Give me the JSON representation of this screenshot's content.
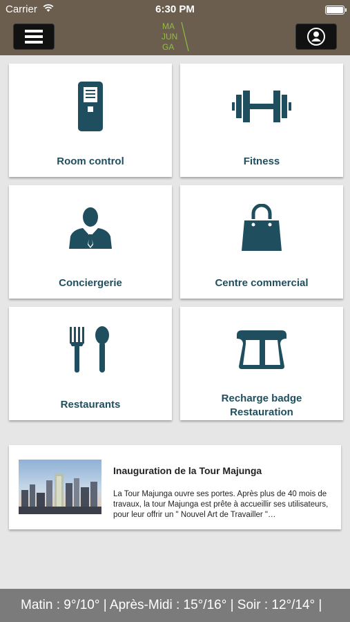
{
  "status_bar": {
    "carrier": "Carrier",
    "time": "6:30 PM",
    "battery_level": 1.0
  },
  "header": {
    "logo_text": [
      "MA",
      "JUN",
      "GA"
    ],
    "menu_icon": "hamburger-icon",
    "profile_icon": "user-icon"
  },
  "tiles": [
    {
      "label": "Room control",
      "icon": "room-control-icon"
    },
    {
      "label": "Fitness",
      "icon": "dumbbell-icon"
    },
    {
      "label": "Conciergerie",
      "icon": "concierge-icon"
    },
    {
      "label": "Centre commercial",
      "icon": "shopping-bag-icon"
    },
    {
      "label": "Restaurants",
      "icon": "fork-spoon-icon"
    },
    {
      "label_line1": "Recharge badge",
      "label_line2": "Restauration",
      "icon": "badge-reader-icon"
    }
  ],
  "news": {
    "title": "Inauguration de la Tour Majunga",
    "excerpt": "La Tour Majunga ouvre ses portes. Après plus de 40 mois de travaux, la tour Majunga est prête à accueillir ses utilisateurs, pour leur offrir un \" Nouvel Art de Travailler \"…"
  },
  "weather": {
    "text": "Matin : 9°/10° | Après-Midi : 15°/16° | Soir : 12°/14° |"
  },
  "colors": {
    "header_bg": "#6b5e4e",
    "icon": "#1f4f5f",
    "logo_green": "#8fbf3f",
    "weather_bg": "#7b7b7b"
  }
}
